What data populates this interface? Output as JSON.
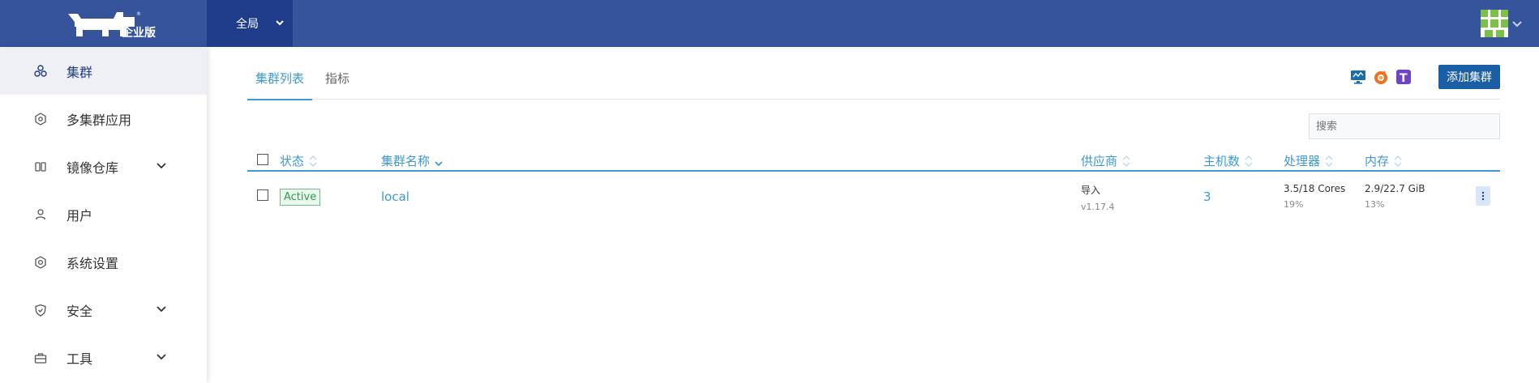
{
  "header": {
    "logo_text": "企业版",
    "scope_label": "全局"
  },
  "sidebar": {
    "items": [
      {
        "label": "集群",
        "active": true,
        "expandable": false,
        "icon": "cluster-icon"
      },
      {
        "label": "多集群应用",
        "active": false,
        "expandable": false,
        "icon": "multi-cluster-app-icon"
      },
      {
        "label": "镜像仓库",
        "active": false,
        "expandable": true,
        "icon": "registry-icon"
      },
      {
        "label": "用户",
        "active": false,
        "expandable": false,
        "icon": "user-icon"
      },
      {
        "label": "系统设置",
        "active": false,
        "expandable": false,
        "icon": "settings-icon"
      },
      {
        "label": "安全",
        "active": false,
        "expandable": true,
        "icon": "shield-icon"
      },
      {
        "label": "工具",
        "active": false,
        "expandable": true,
        "icon": "toolbox-icon"
      }
    ]
  },
  "tabs": [
    {
      "label": "集群列表",
      "active": true
    },
    {
      "label": "指标",
      "active": false
    }
  ],
  "toolbar": {
    "add_cluster_label": "添加集群",
    "search_placeholder": "搜索"
  },
  "table": {
    "columns": {
      "state": "状态",
      "name": "集群名称",
      "provider": "供应商",
      "nodes": "主机数",
      "cpu": "处理器",
      "memory": "内存"
    },
    "rows": [
      {
        "state": "Active",
        "name": "local",
        "provider": "导入",
        "provider_version": "v1.17.4",
        "nodes": "3",
        "cpu": "3.5/18 Cores",
        "cpu_pct": "19%",
        "memory": "2.9/22.7 GiB",
        "memory_pct": "13%"
      }
    ]
  },
  "colors": {
    "header_bg": "#35549c",
    "scope_bg": "#1f3d8a",
    "accent": "#3d98d3",
    "primary_button": "#1a5ea6",
    "active_badge": "#2e9c4e"
  }
}
